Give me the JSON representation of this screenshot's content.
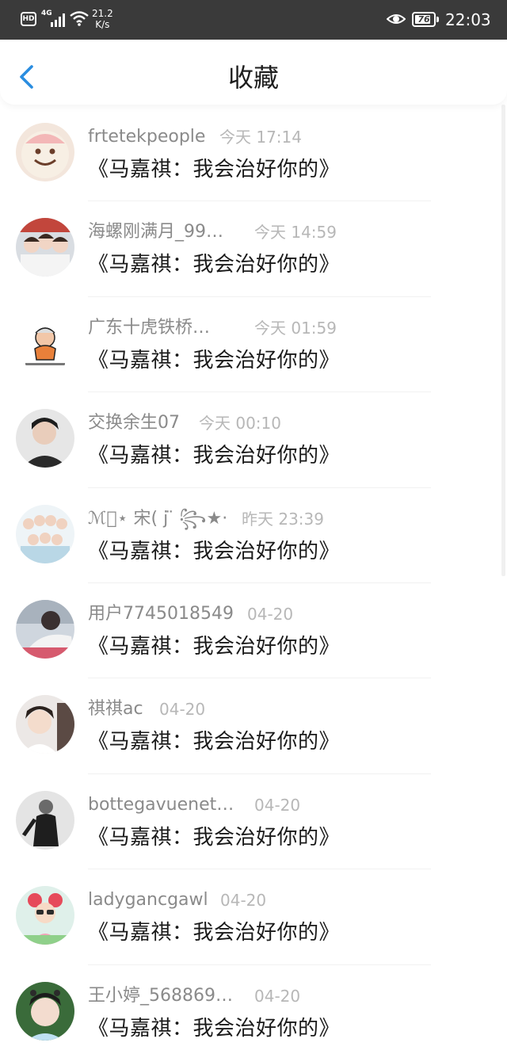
{
  "status_bar": {
    "hd": "HD",
    "network": "4G",
    "speed_value": "21.2",
    "speed_unit": "K/s",
    "battery": "76",
    "time": "22:03"
  },
  "header": {
    "title": "收藏",
    "back_icon": "chevron-left-icon"
  },
  "colors": {
    "status_bar_bg": "#3a3a3a",
    "accent_back": "#2a8de0",
    "username": "#8a8a8a",
    "time": "#b7b7b7",
    "content_text": "#1a1a1a"
  },
  "items": [
    {
      "user": "frtetekpeople",
      "time": "今天 17:14",
      "content": "《马嘉祺：我会治好你的》"
    },
    {
      "user": "海螺刚满月_99…",
      "time": "今天 14:59",
      "content": "《马嘉祺：我会治好你的》"
    },
    {
      "user": "广东十虎铁桥…",
      "time": "今天 01:59",
      "content": "《马嘉祺：我会治好你的》"
    },
    {
      "user": "交换余生07",
      "time": "今天 00:10",
      "content": "《马嘉祺：我会治好你的》"
    },
    {
      "user": "ℳ᭄⋆ 宋( j ̈ ꧂★·",
      "time": "昨天 23:39",
      "content": "《马嘉祺：我会治好你的》"
    },
    {
      "user": "用户7745018549",
      "time": "04-20",
      "content": "《马嘉祺：我会治好你的》"
    },
    {
      "user": "祺祺ac",
      "time": "04-20",
      "content": "《马嘉祺：我会治好你的》"
    },
    {
      "user": "bottegavuenet…",
      "time": "04-20",
      "content": "《马嘉祺：我会治好你的》"
    },
    {
      "user": "ladygancgawl",
      "time": "04-20",
      "content": "《马嘉祺：我会治好你的》"
    },
    {
      "user": "王小婷_568869…",
      "time": "04-20",
      "content": "《马嘉祺：我会治好你的》"
    }
  ]
}
